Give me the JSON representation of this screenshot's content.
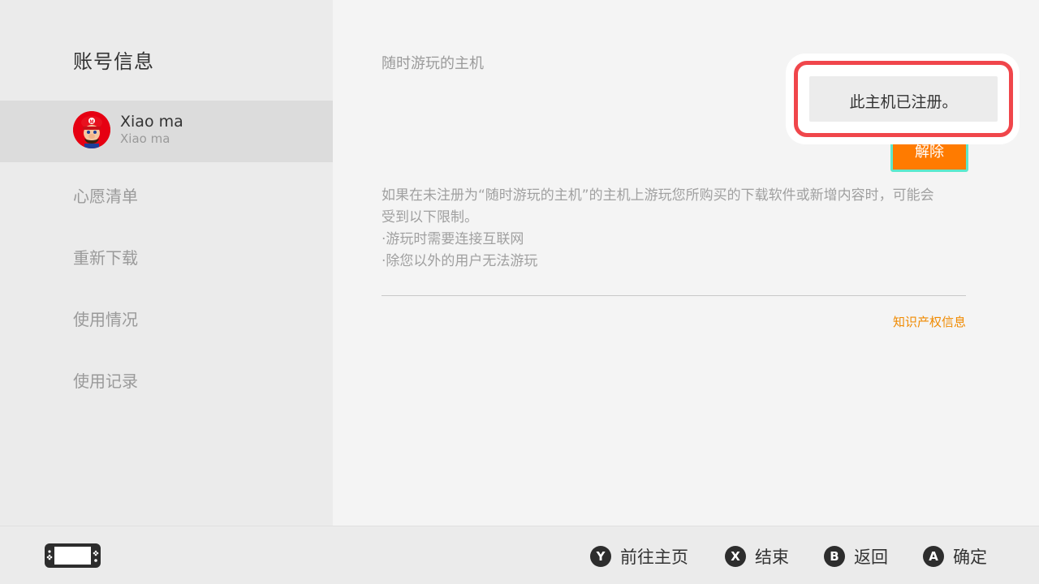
{
  "sidebar": {
    "title": "账号信息",
    "account": {
      "name": "Xiao ma",
      "sub": "Xiao ma"
    },
    "nav": [
      "心愿清单",
      "重新下载",
      "使用情况",
      "使用记录"
    ]
  },
  "main": {
    "section_title": "随时游玩的主机",
    "unregister_button": "解除",
    "description_lines": [
      "如果在未注册为“随时游玩的主机”的主机上游玩您所购买的下载软件或新增内容时，可能会",
      "受到以下限制。",
      "·游玩时需要连接互联网",
      "·除您以外的用户无法游玩"
    ],
    "ip_link": "知识产权信息"
  },
  "popup": {
    "message": "此主机已注册。"
  },
  "footer": {
    "hints": [
      {
        "key": "Y",
        "label": "前往主页"
      },
      {
        "key": "X",
        "label": "结束"
      },
      {
        "key": "B",
        "label": "返回"
      },
      {
        "key": "A",
        "label": "确定"
      }
    ]
  },
  "colors": {
    "accent_orange": "#ff7b00",
    "focus_cyan": "#5de8cc",
    "highlight_red": "#f0464b",
    "link_orange": "#f08a00"
  }
}
